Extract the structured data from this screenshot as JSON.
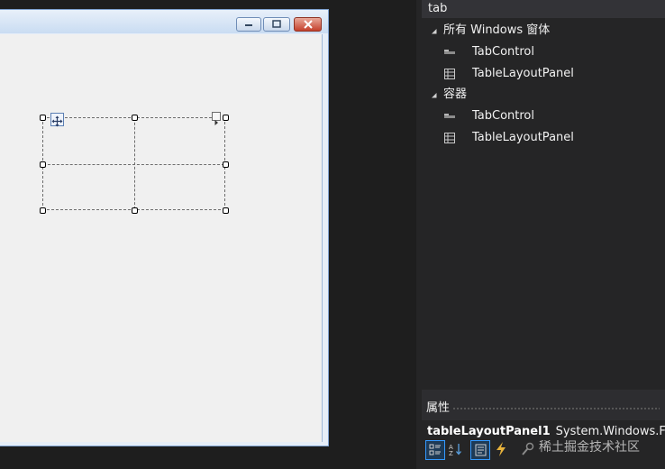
{
  "toolbox": {
    "search_value": "tab",
    "groups": [
      {
        "label": "所有 Windows 窗体",
        "items": [
          {
            "label": "TabControl",
            "icon": "tabcontrol-icon"
          },
          {
            "label": "TableLayoutPanel",
            "icon": "tablelayoutpanel-icon"
          }
        ]
      },
      {
        "label": "容器",
        "items": [
          {
            "label": "TabControl",
            "icon": "tabcontrol-icon"
          },
          {
            "label": "TableLayoutPanel",
            "icon": "tablelayoutpanel-icon"
          }
        ]
      }
    ]
  },
  "properties": {
    "title": "属性",
    "object_name": "tableLayoutPanel1",
    "object_type": "System.Windows.Forms.TableLayoutPanel",
    "toolbar": [
      "categorized-icon",
      "alphabetical-icon",
      "properties-icon",
      "events-icon",
      "property-pages-icon"
    ]
  },
  "watermark": "稀土掘金技术社区",
  "colors": {
    "ide_background": "#1e1e1e",
    "panel_background": "#252526",
    "form_client": "#f0f0f0",
    "selection_accent": "#3399ff",
    "close_button": "#c4402c"
  }
}
